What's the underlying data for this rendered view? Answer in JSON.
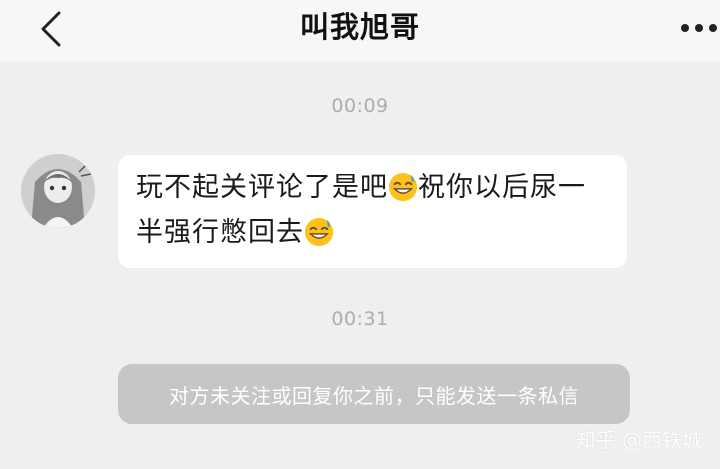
{
  "header": {
    "title": "叫我旭哥",
    "back_icon": "chevron-left-icon",
    "more_icon": "more-dots-icon"
  },
  "messages": [
    {
      "time": "00:09",
      "sender": "other",
      "avatar_icon": "anime-girl-avatar",
      "text_parts": [
        "玩不起关评论了是吧",
        "祝你以后尿一半强行憋回去"
      ],
      "emoji": "grinning-sweat-emoji"
    },
    {
      "time": "00:31",
      "notice": "对方未关注或回复你之前，只能发送一条私信"
    }
  ],
  "watermark": "知乎 @西铁城",
  "colors": {
    "background": "#efefef",
    "topbar": "#f7f7f7",
    "bubble": "#ffffff",
    "notice_bg": "#c6c6c6",
    "timestamp": "#adadad"
  }
}
